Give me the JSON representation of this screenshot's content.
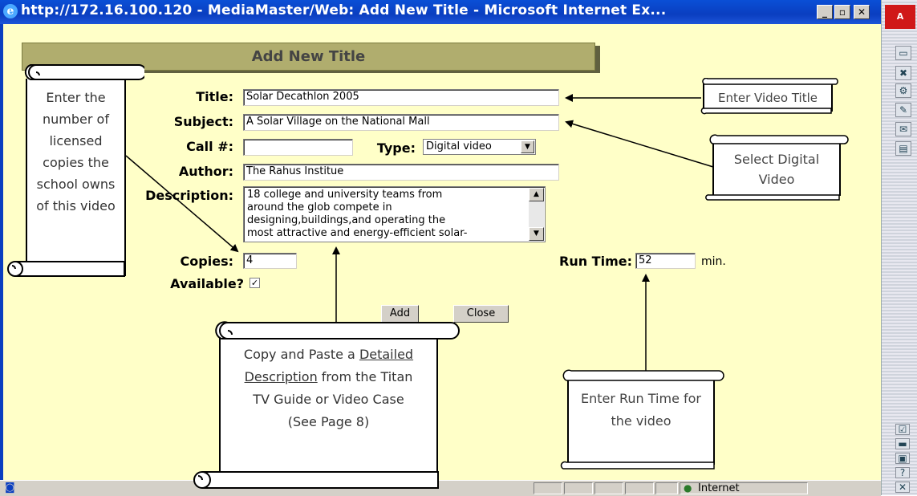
{
  "window": {
    "title": "http://172.16.100.120 - MediaMaster/Web: Add New Title - Microsoft Internet Ex...",
    "minimize": "_",
    "maximize": "▫",
    "close": "✕"
  },
  "status_bar": {
    "zone": "Internet"
  },
  "right_toolbar": {
    "adobe": "A"
  },
  "form": {
    "header": "Add New Title",
    "title_label": "Title:",
    "title_value": "Solar Decathlon 2005",
    "subject_label": "Subject:",
    "subject_value": "A Solar Village on the National Mall",
    "call_label": "Call #:",
    "call_value": "",
    "type_label": "Type:",
    "type_value": "Digital video",
    "author_label": "Author:",
    "author_value": "The Rahus Institue",
    "description_label": "Description:",
    "description_value": "18 college and university teams from\naround the glob compete in\ndesigning,buildings,and operating the\nmost attractive and energy-efficient solar-",
    "copies_label": "Copies:",
    "copies_value": "4",
    "runtime_label": "Run Time:",
    "runtime_value": "52",
    "runtime_unit": "min.",
    "available_label": "Available?",
    "available_checked": true,
    "add_button": "Add",
    "close_button": "Close"
  },
  "callouts": {
    "copies_note": "Enter the number of licensed copies the school owns of this video",
    "copies_note_lines": [
      "Enter the",
      "number of",
      "licensed",
      "copies the",
      "school owns",
      "of this video"
    ],
    "title_note": "Enter Video Title",
    "type_note_lines": [
      "Select Digital",
      "Video"
    ],
    "desc_note_lines": [
      "Copy and Paste a ",
      "Detailed",
      "Description",
      " from the Titan",
      "TV Guide or Video Case",
      "(See Page 8)"
    ],
    "runtime_note_lines": [
      "Enter Run Time for",
      "the video"
    ]
  },
  "colors": {
    "page_bg": "#ffffc8",
    "header_bg": "#b0ad6e",
    "titlebar": "#0a3ec0"
  }
}
